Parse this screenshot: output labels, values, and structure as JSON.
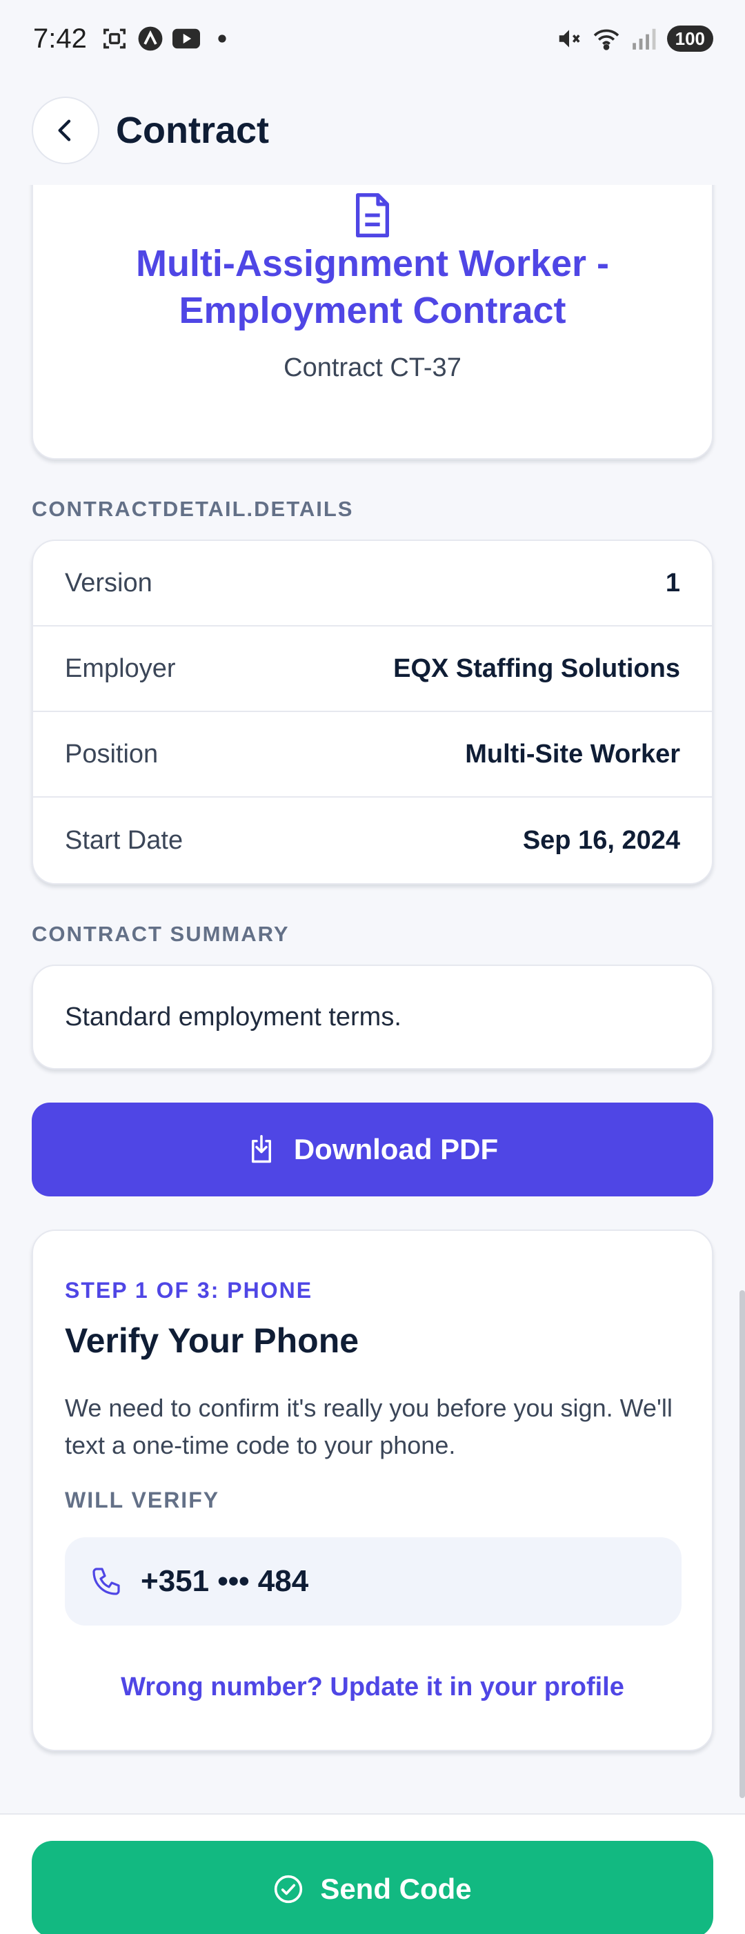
{
  "status_bar": {
    "time": "7:42",
    "battery": "100",
    "icons_left": [
      "screenshot-icon",
      "arc-icon",
      "youtube-icon",
      "dot-icon"
    ],
    "icons_right": [
      "mute-icon",
      "wifi-icon",
      "signal-icon",
      "battery-icon"
    ]
  },
  "header": {
    "title": "Contract",
    "back_icon": "chevron-left-icon"
  },
  "contract": {
    "title": "Multi-Assignment Worker - Employment Contract",
    "id_text": "Contract CT-37",
    "icon": "document-icon"
  },
  "details": {
    "section_label": "CONTRACTDETAIL.DETAILS",
    "rows": [
      {
        "label": "Version",
        "value": "1"
      },
      {
        "label": "Employer",
        "value": "EQX Staffing Solutions"
      },
      {
        "label": "Position",
        "value": "Multi-Site Worker"
      },
      {
        "label": "Start Date",
        "value": "Sep 16, 2024"
      }
    ]
  },
  "summary": {
    "section_label": "CONTRACT SUMMARY",
    "text": "Standard employment terms."
  },
  "download": {
    "label": "Download PDF",
    "icon": "download-icon"
  },
  "verify": {
    "step_label": "STEP 1 OF 3: PHONE",
    "title": "Verify Your Phone",
    "description": "We need to confirm it's really you before you sign. We'll text a one-time code to your phone.",
    "will_verify_label": "WILL VERIFY",
    "phone_number": "+351 ••• 484",
    "phone_icon": "phone-icon",
    "update_link": "Wrong number? Update it in your profile"
  },
  "send": {
    "label": "Send Code",
    "icon": "check-circle-icon"
  },
  "colors": {
    "accent": "#4f46e5",
    "success": "#12b981",
    "text_primary": "#0f1d35",
    "background": "#f6f7fb"
  }
}
